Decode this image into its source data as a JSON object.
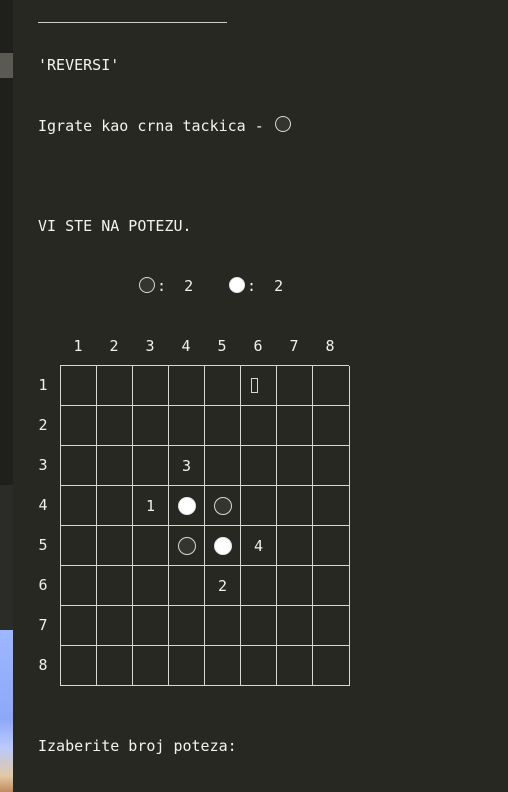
{
  "header": {
    "title": "'REVERSI'",
    "player_info": "Igrate kao crna tackica - ",
    "player_piece": "black",
    "turn_status": "VI STE NA POTEZU."
  },
  "score": {
    "black": {
      "piece": "black",
      "text": ":  2"
    },
    "white": {
      "piece": "white",
      "text": ":  2"
    }
  },
  "board": {
    "col_labels": [
      "1",
      "2",
      "3",
      "4",
      "5",
      "6",
      "7",
      "8"
    ],
    "row_labels": [
      "1",
      "2",
      "3",
      "4",
      "5",
      "6",
      "7",
      "8"
    ],
    "pieces": [
      {
        "row": 4,
        "col": 4,
        "color": "white"
      },
      {
        "row": 4,
        "col": 5,
        "color": "black"
      },
      {
        "row": 5,
        "col": 4,
        "color": "black"
      },
      {
        "row": 5,
        "col": 5,
        "color": "white"
      }
    ],
    "move_options": [
      {
        "row": 4,
        "col": 3,
        "label": "1"
      },
      {
        "row": 6,
        "col": 5,
        "label": "2"
      },
      {
        "row": 3,
        "col": 4,
        "label": "3"
      },
      {
        "row": 5,
        "col": 6,
        "label": "4"
      }
    ],
    "cursor": {
      "row": 1,
      "col": 6
    }
  },
  "prompt": {
    "text": "Izaberite broj poteza:"
  },
  "colors": {
    "background": "#272822",
    "text": "#f3f3ec",
    "grid": "#d8d8d0",
    "black_piece": "#353530",
    "white_piece": "#ffffff"
  }
}
